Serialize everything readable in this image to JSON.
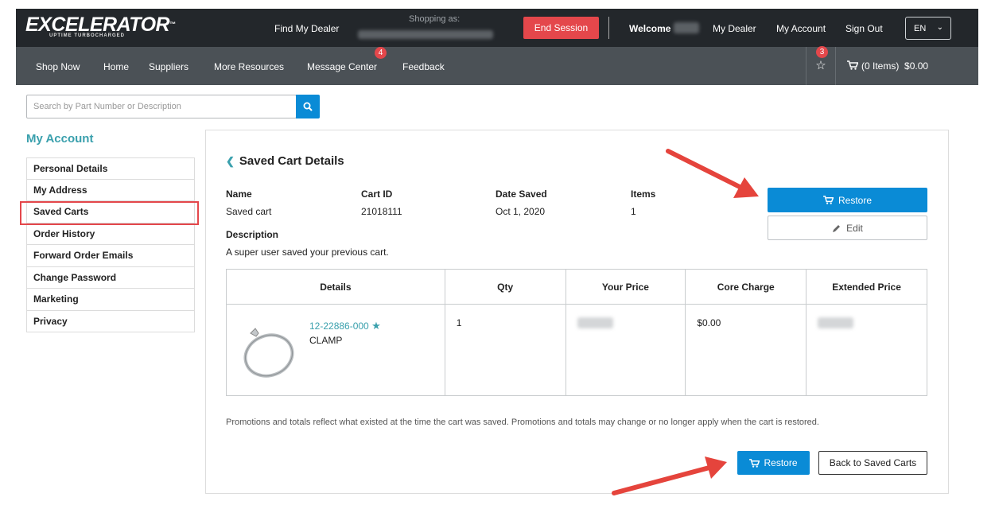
{
  "header": {
    "logo": "EXCELERATOR",
    "logo_tm": "™",
    "logo_tagline": "UPTIME TURBOCHARGED",
    "find_dealer": "Find My Dealer",
    "shopping_as_label": "Shopping as:",
    "end_session": "End Session",
    "welcome": "Welcome",
    "my_dealer": "My Dealer",
    "my_account": "My Account",
    "sign_out": "Sign Out",
    "language": "EN"
  },
  "nav": {
    "items": [
      "Shop Now",
      "Home",
      "Suppliers",
      "More Resources",
      "Message Center",
      "Feedback"
    ],
    "message_badge": "4",
    "wishlist_badge": "3",
    "cart_items": "(0 Items)",
    "cart_total": "$0.00"
  },
  "search": {
    "placeholder": "Search by Part Number or Description"
  },
  "sidebar": {
    "title": "My Account",
    "items": [
      "Personal Details",
      "My Address",
      "Saved Carts",
      "Order History",
      "Forward Order Emails",
      "Change Password",
      "Marketing",
      "Privacy"
    ],
    "active": "Saved Carts"
  },
  "cart": {
    "heading": "Saved Cart Details",
    "labels": {
      "name": "Name",
      "cart_id": "Cart ID",
      "date_saved": "Date Saved",
      "items": "Items",
      "description": "Description"
    },
    "name": "Saved cart",
    "cart_id": "21018111",
    "date_saved": "Oct 1, 2020",
    "items": "1",
    "description": "A super user saved your previous cart.",
    "restore_label": "Restore",
    "edit_label": "Edit"
  },
  "table": {
    "headers": [
      "Details",
      "Qty",
      "Your Price",
      "Core Charge",
      "Extended Price"
    ],
    "rows": [
      {
        "part_number": "12-22886-000",
        "part_name": "CLAMP",
        "qty": "1",
        "core_charge": "$0.00"
      }
    ]
  },
  "footer": {
    "promo_note": "Promotions and totals reflect what existed at the time the cart was saved. Promotions and totals may change or no longer apply when the cart is restored.",
    "restore_label": "Restore",
    "back_label": "Back to Saved Carts"
  },
  "colors": {
    "topbar": "#23272b",
    "navbar": "#4b5156",
    "accent_blue": "#0a8bd6",
    "accent_teal": "#3aa0ad",
    "danger_red": "#e4474b"
  }
}
